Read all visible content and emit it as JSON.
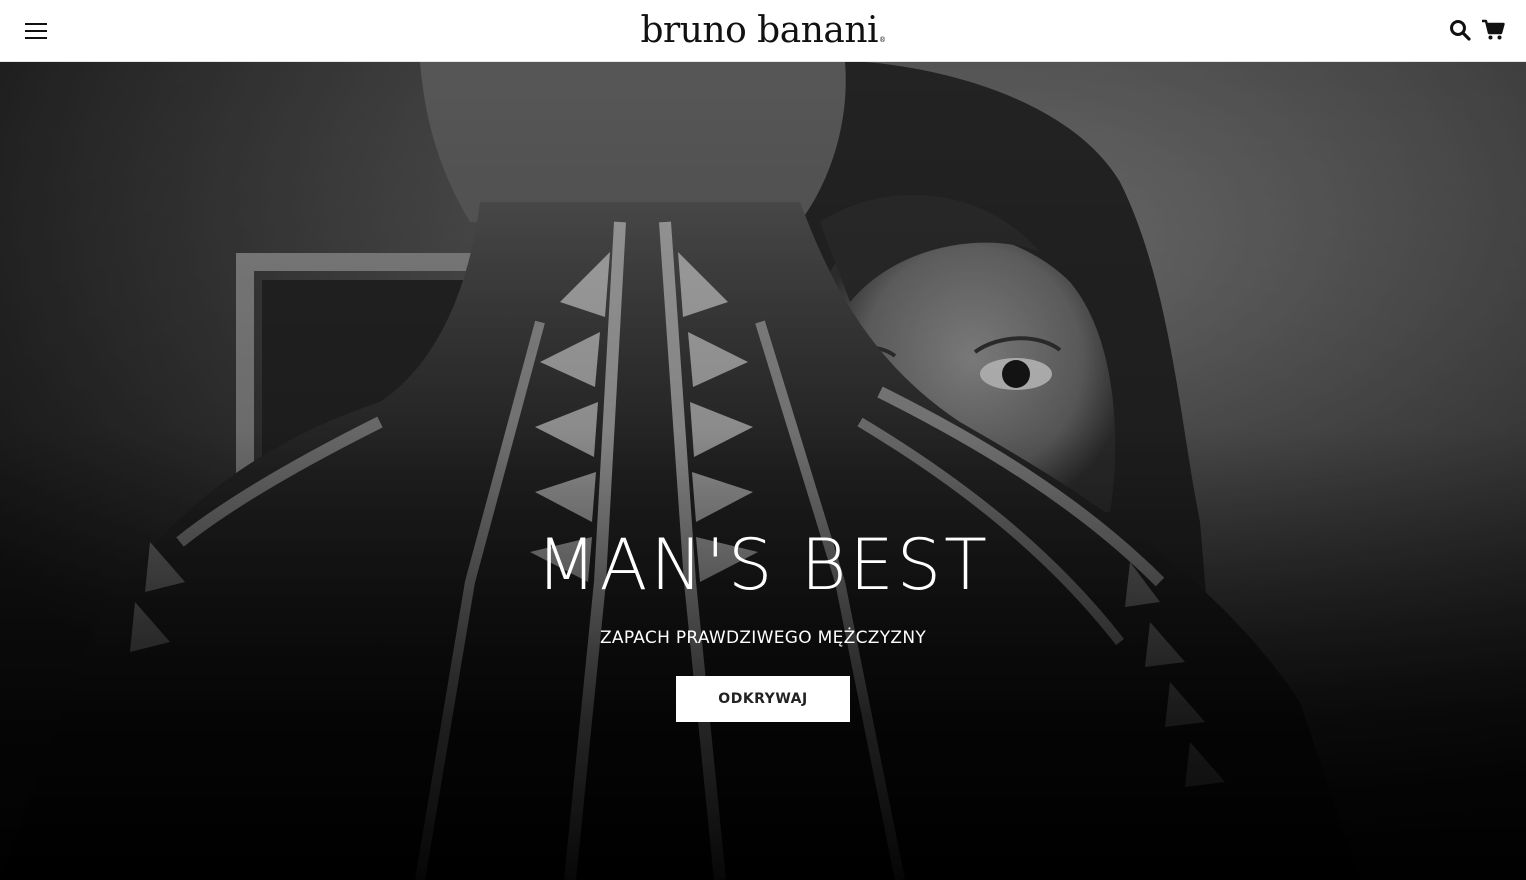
{
  "header": {
    "brand": "bruno banani",
    "brand_mark": "®",
    "menu_icon": "hamburger-menu-icon",
    "search_icon": "search-icon",
    "cart_icon": "shopping-cart-icon"
  },
  "hero": {
    "title": "MAN'S BEST",
    "subtitle": "ZAPACH PRAWDZIWEGO MĘŻCZYZNY",
    "cta_label": "ODKRYWAJ",
    "image": "black-and-white photo of tattooed man's back with woman peeking over his shoulder"
  },
  "colors": {
    "header_bg": "#ffffff",
    "text_dark": "#111111",
    "hero_text": "#ffffff",
    "cta_bg": "#ffffff",
    "cta_text": "#222222"
  }
}
